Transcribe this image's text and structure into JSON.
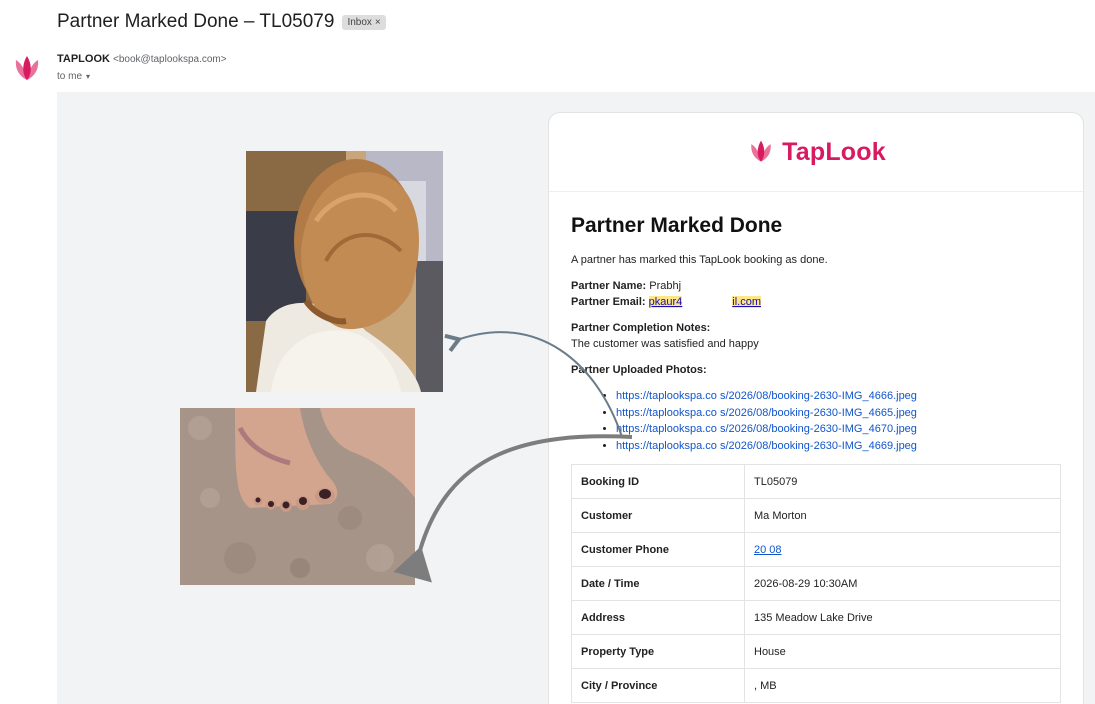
{
  "email": {
    "subject": "Partner Marked Done – TL05079",
    "label_chip": "Inbox",
    "chip_close": "×",
    "sender_name": "TAPLOOK",
    "sender_email": "<book@taplookspa.com>",
    "to_line": "to me",
    "to_caret": "▾"
  },
  "colors": {
    "brand": "#d81b60",
    "link": "#1155cc",
    "highlight": "#fce58a"
  },
  "card": {
    "brand_name": "TapLook",
    "title": "Partner Marked Done",
    "intro": "A partner has marked this TapLook booking as done.",
    "partner_name_label": "Partner Name:",
    "partner_name_value": "Prabhj",
    "partner_email_label": "Partner Email:",
    "partner_email_part1": "pkaur4",
    "partner_email_part2": "il.com",
    "notes_label": "Partner Completion Notes:",
    "notes_value": "The customer was satisfied and happy",
    "photos_label": "Partner Uploaded Photos:",
    "photo_links": [
      {
        "start": "https://taplookspa.co",
        "end": "s/2026/08/booking-2630-IMG_4666.jpeg"
      },
      {
        "start": "https://taplookspa.co",
        "end": "s/2026/08/booking-2630-IMG_4665.jpeg"
      },
      {
        "start": "https://taplookspa.co",
        "end": "s/2026/08/booking-2630-IMG_4670.jpeg"
      },
      {
        "start": "https://taplookspa.co",
        "end": "s/2026/08/booking-2630-IMG_4669.jpeg"
      }
    ],
    "table": [
      {
        "key": "Booking ID",
        "value": "TL05079"
      },
      {
        "key": "Customer",
        "value": "Ma     Morton"
      },
      {
        "key": "Customer Phone",
        "value": "20         08"
      },
      {
        "key": "Date / Time",
        "value": "2026-08-29 10:30AM"
      },
      {
        "key": "Address",
        "value": "135 Meadow Lake Drive"
      },
      {
        "key": "Property Type",
        "value": "House"
      },
      {
        "key": "City / Province",
        "value": ", MB"
      }
    ]
  },
  "photos": [
    {
      "subject": "hair-styled-photo"
    },
    {
      "subject": "pedicure-feet-photo"
    }
  ]
}
